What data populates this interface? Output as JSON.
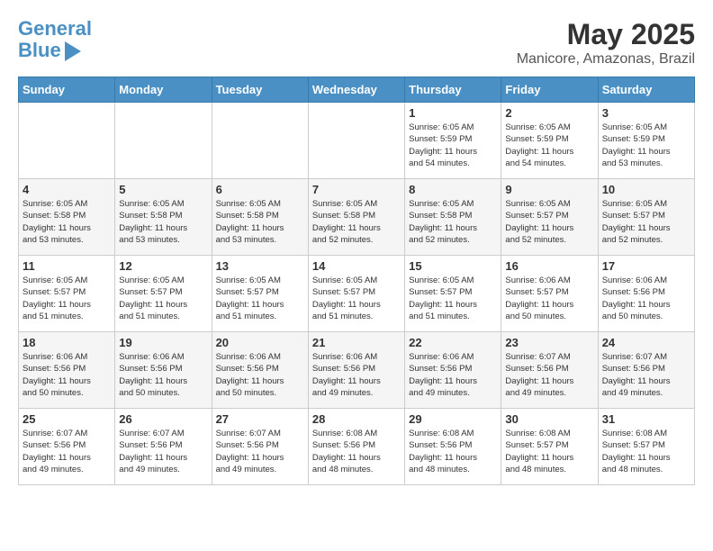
{
  "header": {
    "logo_line1": "General",
    "logo_line2": "Blue",
    "month": "May 2025",
    "location": "Manicore, Amazonas, Brazil"
  },
  "weekdays": [
    "Sunday",
    "Monday",
    "Tuesday",
    "Wednesday",
    "Thursday",
    "Friday",
    "Saturday"
  ],
  "weeks": [
    [
      {
        "day": "",
        "info": ""
      },
      {
        "day": "",
        "info": ""
      },
      {
        "day": "",
        "info": ""
      },
      {
        "day": "",
        "info": ""
      },
      {
        "day": "1",
        "info": "Sunrise: 6:05 AM\nSunset: 5:59 PM\nDaylight: 11 hours\nand 54 minutes."
      },
      {
        "day": "2",
        "info": "Sunrise: 6:05 AM\nSunset: 5:59 PM\nDaylight: 11 hours\nand 54 minutes."
      },
      {
        "day": "3",
        "info": "Sunrise: 6:05 AM\nSunset: 5:59 PM\nDaylight: 11 hours\nand 53 minutes."
      }
    ],
    [
      {
        "day": "4",
        "info": "Sunrise: 6:05 AM\nSunset: 5:58 PM\nDaylight: 11 hours\nand 53 minutes."
      },
      {
        "day": "5",
        "info": "Sunrise: 6:05 AM\nSunset: 5:58 PM\nDaylight: 11 hours\nand 53 minutes."
      },
      {
        "day": "6",
        "info": "Sunrise: 6:05 AM\nSunset: 5:58 PM\nDaylight: 11 hours\nand 53 minutes."
      },
      {
        "day": "7",
        "info": "Sunrise: 6:05 AM\nSunset: 5:58 PM\nDaylight: 11 hours\nand 52 minutes."
      },
      {
        "day": "8",
        "info": "Sunrise: 6:05 AM\nSunset: 5:58 PM\nDaylight: 11 hours\nand 52 minutes."
      },
      {
        "day": "9",
        "info": "Sunrise: 6:05 AM\nSunset: 5:57 PM\nDaylight: 11 hours\nand 52 minutes."
      },
      {
        "day": "10",
        "info": "Sunrise: 6:05 AM\nSunset: 5:57 PM\nDaylight: 11 hours\nand 52 minutes."
      }
    ],
    [
      {
        "day": "11",
        "info": "Sunrise: 6:05 AM\nSunset: 5:57 PM\nDaylight: 11 hours\nand 51 minutes."
      },
      {
        "day": "12",
        "info": "Sunrise: 6:05 AM\nSunset: 5:57 PM\nDaylight: 11 hours\nand 51 minutes."
      },
      {
        "day": "13",
        "info": "Sunrise: 6:05 AM\nSunset: 5:57 PM\nDaylight: 11 hours\nand 51 minutes."
      },
      {
        "day": "14",
        "info": "Sunrise: 6:05 AM\nSunset: 5:57 PM\nDaylight: 11 hours\nand 51 minutes."
      },
      {
        "day": "15",
        "info": "Sunrise: 6:05 AM\nSunset: 5:57 PM\nDaylight: 11 hours\nand 51 minutes."
      },
      {
        "day": "16",
        "info": "Sunrise: 6:06 AM\nSunset: 5:57 PM\nDaylight: 11 hours\nand 50 minutes."
      },
      {
        "day": "17",
        "info": "Sunrise: 6:06 AM\nSunset: 5:56 PM\nDaylight: 11 hours\nand 50 minutes."
      }
    ],
    [
      {
        "day": "18",
        "info": "Sunrise: 6:06 AM\nSunset: 5:56 PM\nDaylight: 11 hours\nand 50 minutes."
      },
      {
        "day": "19",
        "info": "Sunrise: 6:06 AM\nSunset: 5:56 PM\nDaylight: 11 hours\nand 50 minutes."
      },
      {
        "day": "20",
        "info": "Sunrise: 6:06 AM\nSunset: 5:56 PM\nDaylight: 11 hours\nand 50 minutes."
      },
      {
        "day": "21",
        "info": "Sunrise: 6:06 AM\nSunset: 5:56 PM\nDaylight: 11 hours\nand 49 minutes."
      },
      {
        "day": "22",
        "info": "Sunrise: 6:06 AM\nSunset: 5:56 PM\nDaylight: 11 hours\nand 49 minutes."
      },
      {
        "day": "23",
        "info": "Sunrise: 6:07 AM\nSunset: 5:56 PM\nDaylight: 11 hours\nand 49 minutes."
      },
      {
        "day": "24",
        "info": "Sunrise: 6:07 AM\nSunset: 5:56 PM\nDaylight: 11 hours\nand 49 minutes."
      }
    ],
    [
      {
        "day": "25",
        "info": "Sunrise: 6:07 AM\nSunset: 5:56 PM\nDaylight: 11 hours\nand 49 minutes."
      },
      {
        "day": "26",
        "info": "Sunrise: 6:07 AM\nSunset: 5:56 PM\nDaylight: 11 hours\nand 49 minutes."
      },
      {
        "day": "27",
        "info": "Sunrise: 6:07 AM\nSunset: 5:56 PM\nDaylight: 11 hours\nand 49 minutes."
      },
      {
        "day": "28",
        "info": "Sunrise: 6:08 AM\nSunset: 5:56 PM\nDaylight: 11 hours\nand 48 minutes."
      },
      {
        "day": "29",
        "info": "Sunrise: 6:08 AM\nSunset: 5:56 PM\nDaylight: 11 hours\nand 48 minutes."
      },
      {
        "day": "30",
        "info": "Sunrise: 6:08 AM\nSunset: 5:57 PM\nDaylight: 11 hours\nand 48 minutes."
      },
      {
        "day": "31",
        "info": "Sunrise: 6:08 AM\nSunset: 5:57 PM\nDaylight: 11 hours\nand 48 minutes."
      }
    ]
  ]
}
